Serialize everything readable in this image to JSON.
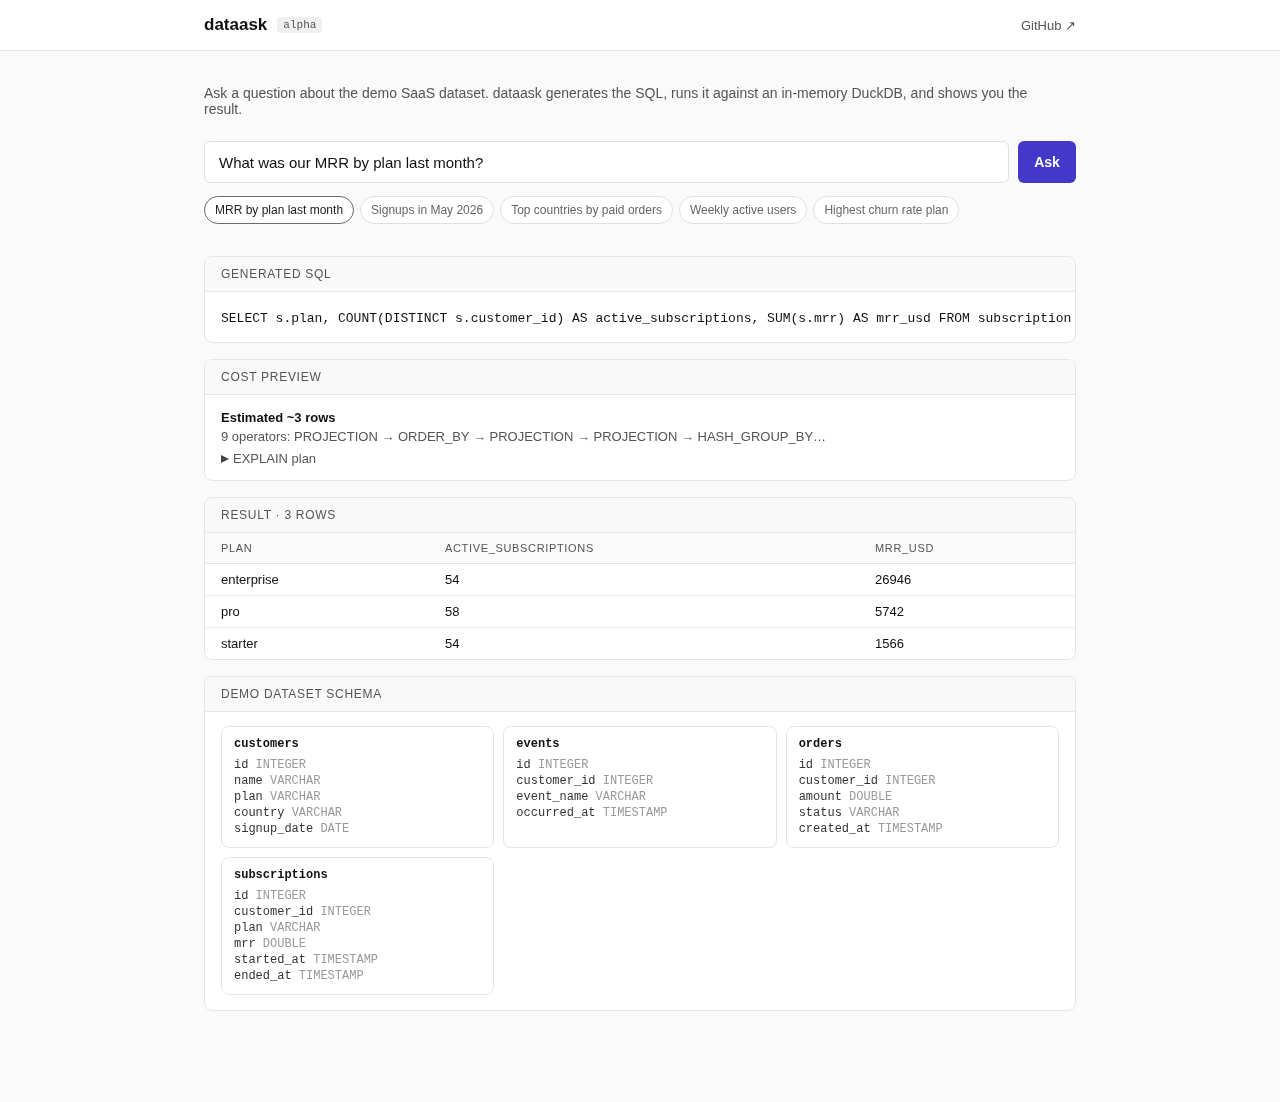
{
  "header": {
    "brand": "dataask",
    "badge": "alpha",
    "link": "GitHub ↗"
  },
  "intro": "Ask a question about the demo SaaS dataset. dataask generates the SQL, runs it against an in-memory DuckDB, and shows you the result.",
  "query": {
    "value": "What was our MRR by plan last month?",
    "button": "Ask"
  },
  "suggestions": [
    {
      "label": "MRR by plan last month",
      "selected": true
    },
    {
      "label": "Signups in May 2026",
      "selected": false
    },
    {
      "label": "Top countries by paid orders",
      "selected": false
    },
    {
      "label": "Weekly active users",
      "selected": false
    },
    {
      "label": "Highest churn rate plan",
      "selected": false
    }
  ],
  "sql_panel": {
    "title": "GENERATED SQL",
    "sql": "SELECT s.plan, COUNT(DISTINCT s.customer_id) AS active_subscriptions, SUM(s.mrr) AS mrr_usd FROM subscription"
  },
  "cost_panel": {
    "title": "COST PREVIEW",
    "estimate": "Estimated ~3 rows",
    "operators": "9 operators: PROJECTION → ORDER_BY → PROJECTION → PROJECTION → HASH_GROUP_BY…",
    "explain": {
      "label": "EXPLAIN plan",
      "expanded": false
    }
  },
  "result_panel": {
    "title": "RESULT · 3 ROWS",
    "table": {
      "columns": [
        "PLAN",
        "ACTIVE_SUBSCRIPTIONS",
        "MRR_USD"
      ],
      "rows": [
        [
          "enterprise",
          "54",
          "26946"
        ],
        [
          "pro",
          "58",
          "5742"
        ],
        [
          "starter",
          "54",
          "1566"
        ]
      ]
    }
  },
  "schema_panel": {
    "title": "DEMO DATASET SCHEMA",
    "tables": [
      {
        "name": "customers",
        "columns": [
          {
            "name": "id",
            "type": "INTEGER"
          },
          {
            "name": "name",
            "type": "VARCHAR"
          },
          {
            "name": "plan",
            "type": "VARCHAR"
          },
          {
            "name": "country",
            "type": "VARCHAR"
          },
          {
            "name": "signup_date",
            "type": "DATE"
          }
        ]
      },
      {
        "name": "events",
        "columns": [
          {
            "name": "id",
            "type": "INTEGER"
          },
          {
            "name": "customer_id",
            "type": "INTEGER"
          },
          {
            "name": "event_name",
            "type": "VARCHAR"
          },
          {
            "name": "occurred_at",
            "type": "TIMESTAMP"
          }
        ]
      },
      {
        "name": "orders",
        "columns": [
          {
            "name": "id",
            "type": "INTEGER"
          },
          {
            "name": "customer_id",
            "type": "INTEGER"
          },
          {
            "name": "amount",
            "type": "DOUBLE"
          },
          {
            "name": "status",
            "type": "VARCHAR"
          },
          {
            "name": "created_at",
            "type": "TIMESTAMP"
          }
        ]
      },
      {
        "name": "subscriptions",
        "columns": [
          {
            "name": "id",
            "type": "INTEGER"
          },
          {
            "name": "customer_id",
            "type": "INTEGER"
          },
          {
            "name": "plan",
            "type": "VARCHAR"
          },
          {
            "name": "mrr",
            "type": "DOUBLE"
          },
          {
            "name": "started_at",
            "type": "TIMESTAMP"
          },
          {
            "name": "ended_at",
            "type": "TIMESTAMP"
          }
        ]
      }
    ]
  }
}
